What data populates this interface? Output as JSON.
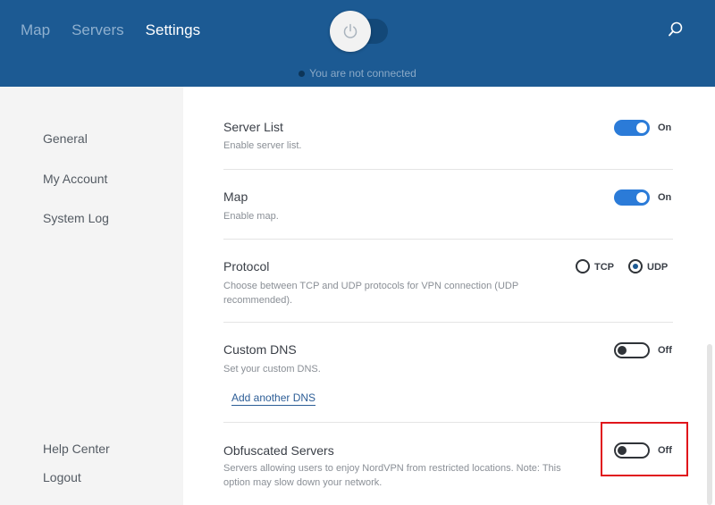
{
  "header": {
    "nav": [
      "Map",
      "Servers",
      "Settings"
    ],
    "active_nav": "Settings",
    "status_text": "You are not connected"
  },
  "sidebar": {
    "items": [
      "General",
      "My Account",
      "System Log"
    ],
    "bottom_items": [
      "Help Center",
      "Logout"
    ]
  },
  "settings": {
    "server_list": {
      "title": "Server List",
      "description": "Enable server list.",
      "state": "On"
    },
    "map": {
      "title": "Map",
      "description": "Enable map.",
      "state": "On"
    },
    "protocol": {
      "title": "Protocol",
      "description": "Choose between TCP and UDP protocols for VPN connection (UDP recommended).",
      "options": [
        "TCP",
        "UDP"
      ],
      "selected": "UDP"
    },
    "custom_dns": {
      "title": "Custom DNS",
      "description": "Set your custom DNS.",
      "state": "Off",
      "link": "Add another DNS"
    },
    "obfuscated": {
      "title": "Obfuscated Servers",
      "description": "Servers allowing users to enjoy NordVPN from restricted locations. Note: This option may slow down your network.",
      "state": "Off"
    }
  },
  "colors": {
    "header_bg": "#1c5a93",
    "toggle_on": "#2b7bd8",
    "highlight": "#e0151b"
  }
}
